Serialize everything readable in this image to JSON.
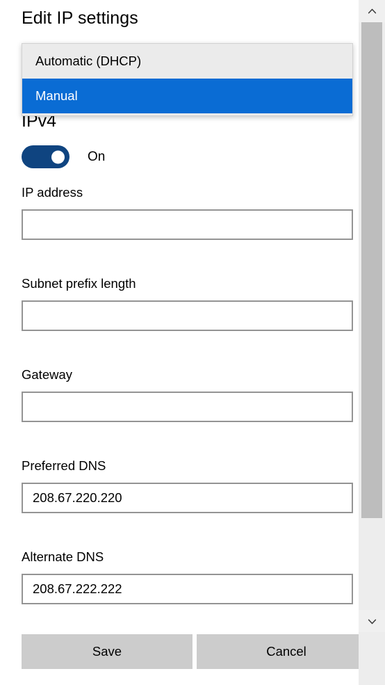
{
  "dialog": {
    "title": "Edit IP settings"
  },
  "combo": {
    "name": "ip-assignment",
    "selected": "Manual",
    "options": [
      {
        "label": "Automatic (DHCP)",
        "selected": false
      },
      {
        "label": "Manual",
        "selected": true
      }
    ],
    "highlight_color": "#0a6cd4",
    "surface_color": "#ebebeb"
  },
  "section": {
    "heading": "IPv4",
    "toggle": {
      "state_label": "On",
      "on": true,
      "on_color": "#0f4480"
    }
  },
  "fields": [
    {
      "key": "ip_address",
      "label": "IP address",
      "value": "",
      "placeholder": ""
    },
    {
      "key": "subnet_prefix_length",
      "label": "Subnet prefix length",
      "value": "",
      "placeholder": ""
    },
    {
      "key": "gateway",
      "label": "Gateway",
      "value": "",
      "placeholder": ""
    },
    {
      "key": "preferred_dns",
      "label": "Preferred DNS",
      "value": "208.67.220.220",
      "placeholder": ""
    },
    {
      "key": "alternate_dns",
      "label": "Alternate DNS",
      "value": "208.67.222.222",
      "placeholder": ""
    }
  ],
  "actions": {
    "save_label": "Save",
    "cancel_label": "Cancel",
    "button_color": "#cccccc"
  },
  "scrollbar": {
    "up_icon": "chevron-up-icon",
    "down_icon": "chevron-down-icon",
    "thumb_color": "#bdbdbd",
    "track_color": "#ededed"
  }
}
